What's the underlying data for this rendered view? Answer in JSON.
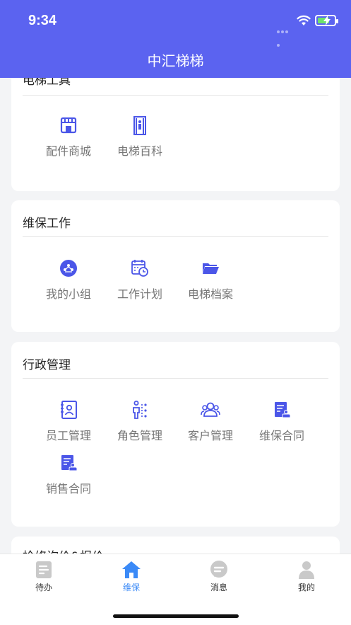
{
  "status": {
    "time": "9:34"
  },
  "header": {
    "title": "中汇梯梯"
  },
  "sections": [
    {
      "title": "电梯工具",
      "items": [
        {
          "label": "配件商城",
          "icon": "store-icon"
        },
        {
          "label": "电梯百科",
          "icon": "elevator-icon"
        }
      ]
    },
    {
      "title": "维保工作",
      "items": [
        {
          "label": "我的小组",
          "icon": "group-icon"
        },
        {
          "label": "工作计划",
          "icon": "calendar-clock-icon"
        },
        {
          "label": "电梯档案",
          "icon": "folder-icon"
        }
      ]
    },
    {
      "title": "行政管理",
      "items": [
        {
          "label": "员工管理",
          "icon": "employee-card-icon"
        },
        {
          "label": "角色管理",
          "icon": "role-icon"
        },
        {
          "label": "客户管理",
          "icon": "customers-icon"
        },
        {
          "label": "维保合同",
          "icon": "contract-icon"
        },
        {
          "label": "销售合同",
          "icon": "contract-icon"
        }
      ]
    },
    {
      "title": "检修询价&报价"
    }
  ],
  "tabs": [
    {
      "label": "待办",
      "icon": "todo-icon"
    },
    {
      "label": "维保",
      "icon": "home-icon"
    },
    {
      "label": "消息",
      "icon": "message-icon"
    },
    {
      "label": "我的",
      "icon": "person-icon"
    }
  ],
  "colors": {
    "primary": "#5b63f0",
    "active_tab": "#3b8af7",
    "icon": "#4b56e8",
    "inactive_tab": "#c9c9c9"
  }
}
